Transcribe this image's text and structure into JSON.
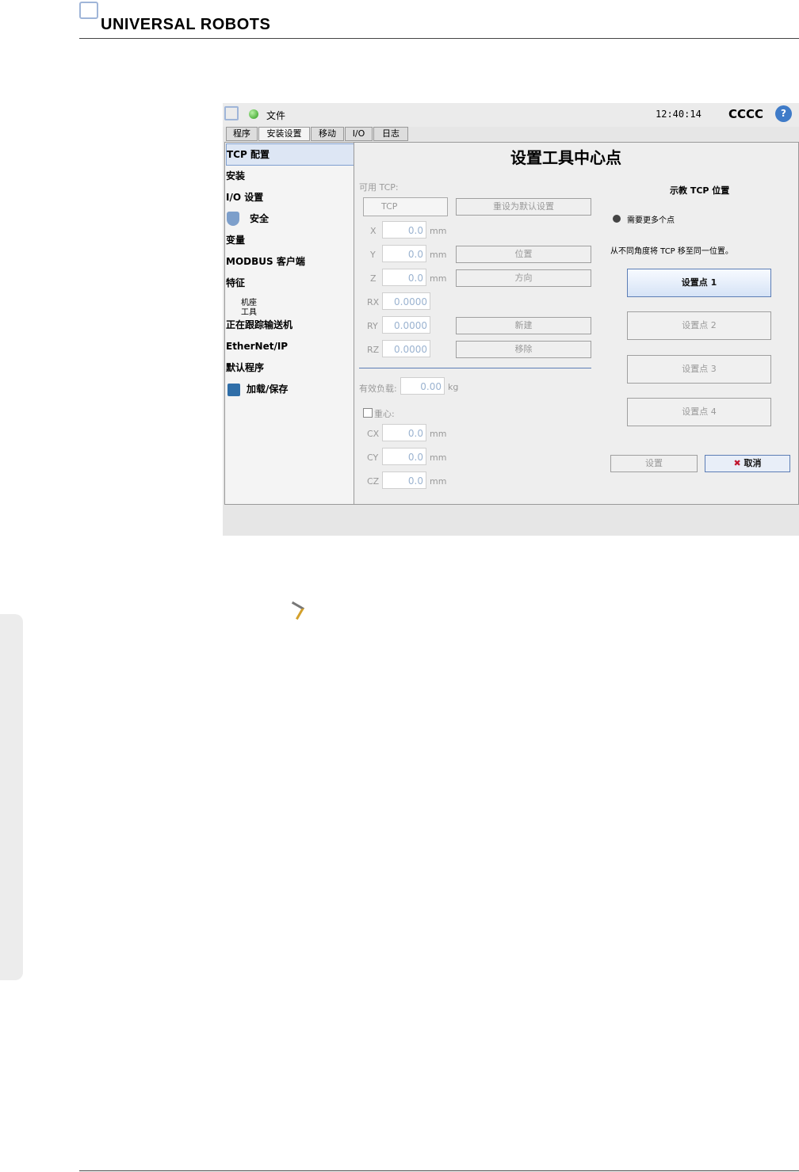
{
  "header": {
    "brand": "UNIVERSAL ROBOTS"
  },
  "app": {
    "file_menu": "文件",
    "time": "12:40:14",
    "robot_name": "CCCC"
  },
  "tabs": [
    "程序",
    "安装设置",
    "移动",
    "I/O",
    "日志"
  ],
  "sidebar": {
    "items": [
      "TCP 配置",
      "安装",
      "I/O 设置",
      "安全",
      "变量",
      "MODBUS 客户端",
      "特征",
      "机座",
      "工具",
      "正在跟踪输送机",
      "EtherNet/IP",
      "默认程序",
      "加载/保存"
    ]
  },
  "main": {
    "title": "设置工具中心点",
    "available_tcp": "可用 TCP:",
    "tcp_select": "TCP",
    "reset_btn": "重设为默认设置",
    "pos_btn": "位置",
    "dir_btn": "方向",
    "new_btn": "新建",
    "remove_btn": "移除",
    "fields": [
      {
        "label": "X",
        "value": "0.0",
        "unit": "mm"
      },
      {
        "label": "Y",
        "value": "0.0",
        "unit": "mm"
      },
      {
        "label": "Z",
        "value": "0.0",
        "unit": "mm"
      },
      {
        "label": "RX",
        "value": "0.0000"
      },
      {
        "label": "RY",
        "value": "0.0000"
      },
      {
        "label": "RZ",
        "value": "0.0000"
      }
    ],
    "payload": {
      "label": "有效负载:",
      "value": "0.00",
      "unit": "kg"
    },
    "cog": {
      "label": "重心:",
      "fields": [
        {
          "label": "CX",
          "value": "0.0",
          "unit": "mm"
        },
        {
          "label": "CY",
          "value": "0.0",
          "unit": "mm"
        },
        {
          "label": "CZ",
          "value": "0.0",
          "unit": "mm"
        }
      ]
    },
    "teach": {
      "title": "示教 TCP 位置",
      "status": "需要更多个点",
      "hint": "从不同角度将 TCP 移至同一位置。",
      "points": [
        "设置点 1",
        "设置点 2",
        "设置点 3",
        "设置点 4"
      ],
      "set_btn": "设置",
      "cancel_btn": "取消"
    }
  }
}
